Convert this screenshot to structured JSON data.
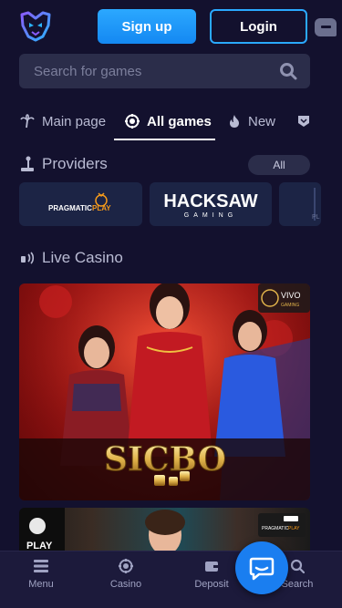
{
  "header": {
    "signup_label": "Sign up",
    "login_label": "Login"
  },
  "search": {
    "placeholder": "Search for games"
  },
  "tabs": [
    {
      "label": "Main page",
      "icon": "palm-tree-icon",
      "active": false
    },
    {
      "label": "All games",
      "icon": "chip-icon",
      "active": true
    },
    {
      "label": "New",
      "icon": "flame-icon",
      "active": false
    }
  ],
  "providers": {
    "title": "Providers",
    "all_label": "All",
    "items": [
      {
        "name": "PRAGMATIC PLAY"
      },
      {
        "name": "HACKSAW",
        "sub": "GAMING"
      }
    ]
  },
  "live_casino": {
    "title": "Live Casino",
    "games": [
      {
        "title": "SICBO",
        "provider_logo": "VIVO",
        "provider_sub": "GAMING"
      },
      {
        "provider_logo": "PLAY",
        "badge": "PRAGMATIC PLAY"
      }
    ]
  },
  "bottom_nav": [
    {
      "label": "Menu",
      "icon": "menu-icon"
    },
    {
      "label": "Casino",
      "icon": "casino-chip-icon"
    },
    {
      "label": "Deposit",
      "icon": "wallet-icon"
    },
    {
      "label": "Search",
      "icon": "search-icon"
    }
  ],
  "colors": {
    "background": "#13112e",
    "accent": "#1a7ef0",
    "surface": "#2b2d4a"
  }
}
